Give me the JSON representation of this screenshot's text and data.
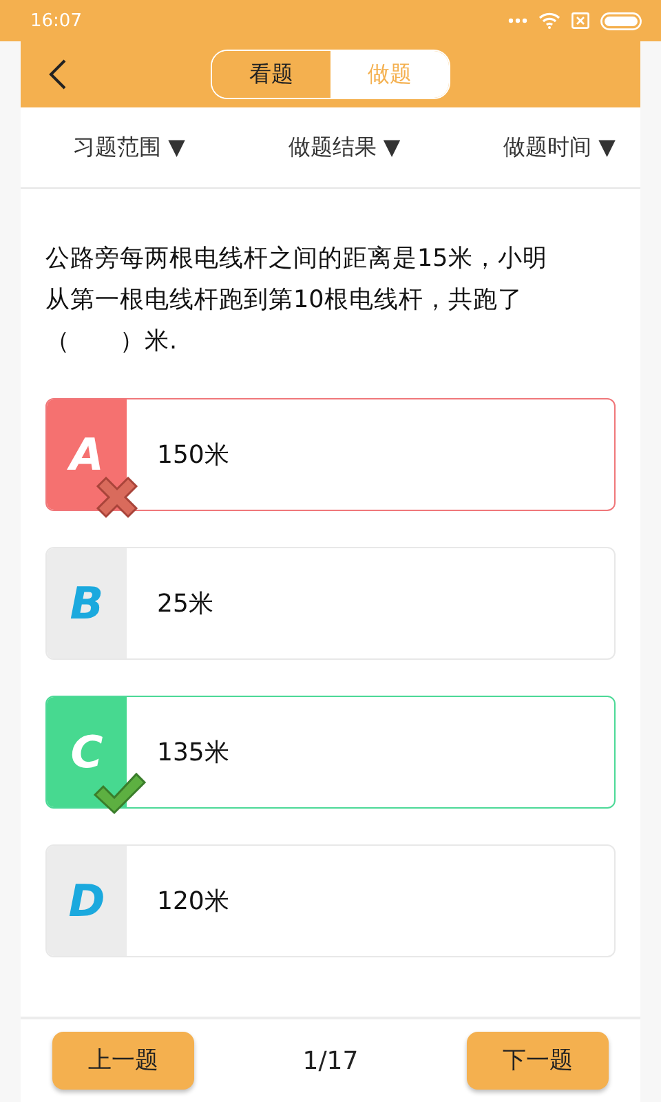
{
  "status_bar": {
    "time": "16:07"
  },
  "header": {
    "tabs": [
      {
        "label": "看题",
        "selected": false
      },
      {
        "label": "做题",
        "selected": true
      }
    ]
  },
  "filters": [
    {
      "label": "习题范围",
      "arrow": "▼"
    },
    {
      "label": "做题结果",
      "arrow": "▼"
    },
    {
      "label": "做题时间",
      "arrow": "▼"
    }
  ],
  "question": {
    "text": "公路旁每两根电线杆之间的距离是15米，小明从第一根电线杆跑到第10根电线杆，共跑了（　　）米.",
    "options": [
      {
        "letter": "A",
        "text": "150米",
        "wrong": true,
        "correct": false
      },
      {
        "letter": "B",
        "text": "25米",
        "wrong": false,
        "correct": false
      },
      {
        "letter": "C",
        "text": "135米",
        "wrong": false,
        "correct": true
      },
      {
        "letter": "D",
        "text": "120米",
        "wrong": false,
        "correct": false
      }
    ]
  },
  "footer": {
    "prev": "上一题",
    "page": "1/17",
    "next": "下一题"
  }
}
